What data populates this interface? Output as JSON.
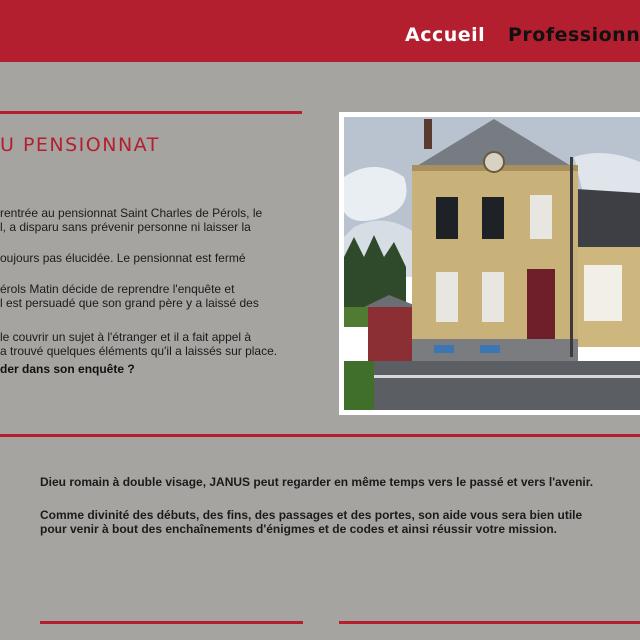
{
  "nav": {
    "accueil": "Accueil",
    "professionnels": "Professionn"
  },
  "section": {
    "title": "U PENSIONNAT",
    "paragraphs": [
      "rentrée au pensionnat Saint Charles de Pérols, le\nl, a disparu sans prévenir personne ni laisser la",
      "oujours pas élucidée. Le pensionnat est fermé",
      "érols Matin décide de reprendre l'enquête et\nl est persuadé que son grand père y a laissé des",
      "le couvrir un sujet à l'étranger et il a fait appel à\na trouvé quelques éléments qu'il a laissés sur place.",
      "der dans son enquête ?"
    ]
  },
  "janus": {
    "paragraphs": [
      "Dieu romain à double visage, JANUS peut regarder en même temps vers le passé et vers l'avenir.",
      "Comme divinité des débuts, des fins, des passages et des portes, son aide vous sera bien utile pour venir à bout des enchaînements d'énigmes et de codes et ainsi réussir votre mission."
    ]
  },
  "colors": {
    "accent": "#b41f2f",
    "background": "#a5a4a0",
    "nav_active": "#ffffff",
    "nav_inactive": "#111111"
  }
}
